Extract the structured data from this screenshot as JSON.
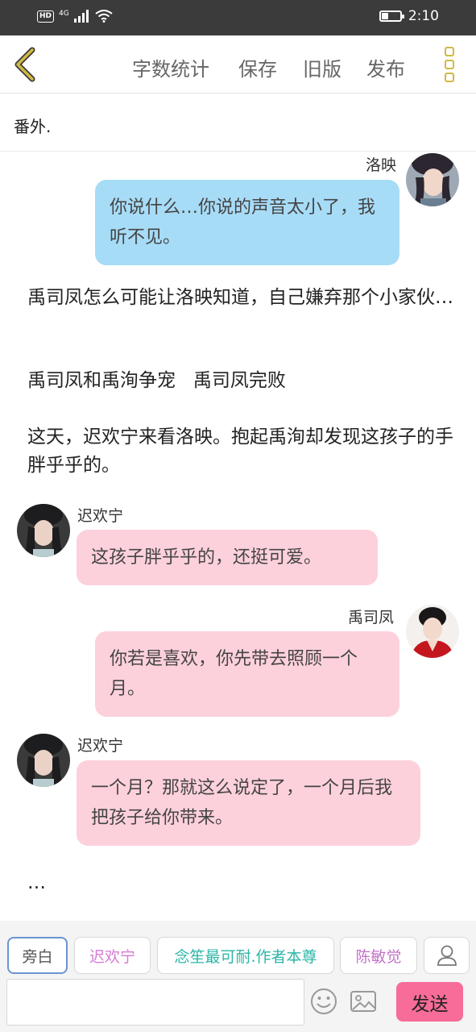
{
  "status_bar": {
    "network_left": "HD",
    "network_type": "4G",
    "time": "2:10",
    "icons": [
      "hd-icon",
      "signal-icon",
      "wifi-icon",
      "battery-icon"
    ]
  },
  "toolbar": {
    "back_icon": "chevron-left-icon",
    "items": [
      "字数统计",
      "保存",
      "旧版",
      "发布"
    ],
    "more_icon": "more-vertical-icon",
    "accent_color": "#d1b944"
  },
  "title": "番外.",
  "messages": [
    {
      "type": "bubble",
      "side": "right",
      "speaker": "洛映",
      "text": "你说什么…你说的声音太小了，我听不见。",
      "color": "#a7dcf7"
    },
    {
      "type": "narration",
      "text": "禹司凤怎么可能让洛映知道，自己嫌弃那个小家伙…"
    },
    {
      "type": "narration",
      "text": "禹司凤和禹洵争宠   禹司凤完败"
    },
    {
      "type": "narration",
      "text": "这天，迟欢宁来看洛映。抱起禹洵却发现这孩子的手胖乎乎的。"
    },
    {
      "type": "bubble",
      "side": "left",
      "speaker": "迟欢宁",
      "text": "这孩子胖乎乎的，还挺可爱。",
      "color": "#fdd1dc"
    },
    {
      "type": "bubble",
      "side": "right",
      "speaker": "禹司凤",
      "text": "你若是喜欢，你先带去照顾一个月。",
      "color": "#fdd1dc"
    },
    {
      "type": "bubble",
      "side": "left",
      "speaker": "迟欢宁",
      "text": "一个月？那就这么说定了，一个月后我把孩子给你带来。",
      "color": "#fdd1dc"
    },
    {
      "type": "narration",
      "text": "…"
    }
  ],
  "bottom_bar": {
    "roles": [
      {
        "label": "旁白",
        "color": "#555555",
        "selected": true
      },
      {
        "label": "迟欢宁",
        "color": "#d77ad6"
      },
      {
        "label": "念笙最可耐.作者本尊",
        "color": "#2bb5a6"
      },
      {
        "label": "陈敏觉",
        "color": "#c472c9"
      }
    ],
    "person_icon": "person-icon",
    "emoji_icon": "emoji-icon",
    "image_icon": "image-icon",
    "input_value": "",
    "send_label": "发送",
    "send_color": "#f76c98"
  }
}
